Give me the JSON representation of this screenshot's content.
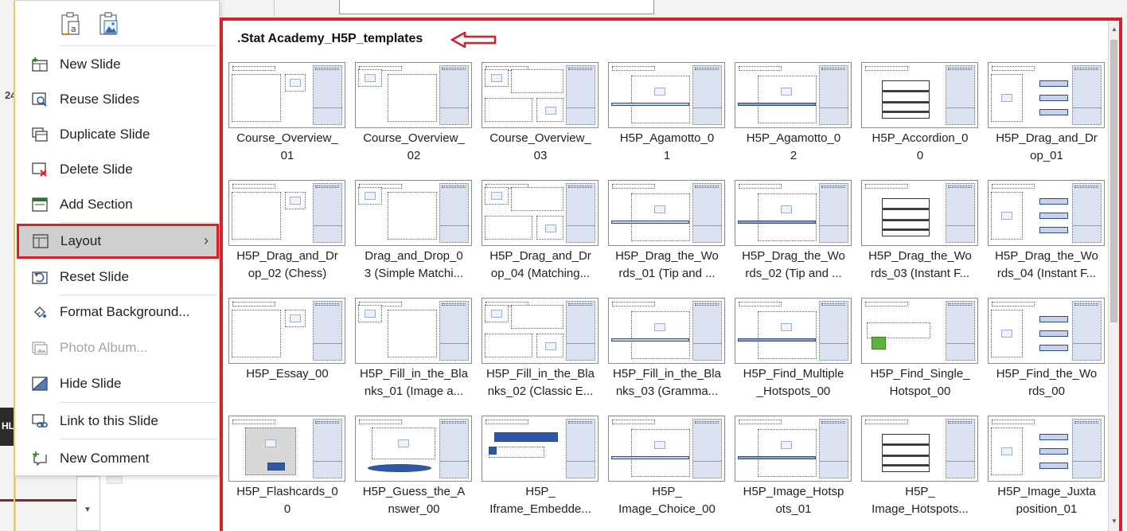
{
  "background": {
    "slide_number": "24",
    "dark_tab": "HL"
  },
  "context_menu": {
    "items": [
      {
        "label": "New Slide",
        "icon": "new-slide-icon",
        "enabled": true
      },
      {
        "label": "Reuse Slides",
        "icon": "reuse-slides-icon",
        "enabled": true
      },
      {
        "label": "Duplicate Slide",
        "icon": "duplicate-slide-icon",
        "enabled": true
      },
      {
        "label": "Delete Slide",
        "icon": "delete-slide-icon",
        "enabled": true
      },
      {
        "label": "Add Section",
        "icon": "add-section-icon",
        "enabled": true
      },
      {
        "label": "Layout",
        "icon": "layout-icon",
        "enabled": true,
        "highlighted": true,
        "has_submenu": true
      },
      {
        "label": "Reset Slide",
        "icon": "reset-slide-icon",
        "enabled": true
      },
      {
        "label": "Format Background...",
        "icon": "format-background-icon",
        "enabled": true
      },
      {
        "label": "Photo Album...",
        "icon": "photo-album-icon",
        "enabled": false
      },
      {
        "label": "Hide Slide",
        "icon": "hide-slide-icon",
        "enabled": true
      },
      {
        "label": "Link to this Slide",
        "icon": "link-slide-icon",
        "enabled": true
      },
      {
        "label": "New Comment",
        "icon": "new-comment-icon",
        "enabled": true
      }
    ],
    "submenu_chevron": "›",
    "colors": {
      "highlight_bg": "#cfcfcf",
      "annotation_red": "#d6202a"
    }
  },
  "gallery": {
    "title": ".Stat Academy_H5P_templates",
    "layouts": [
      {
        "l1": "Course_Overview_",
        "l2": "01"
      },
      {
        "l1": "Course_Overview_",
        "l2": "02"
      },
      {
        "l1": "Course_Overview_",
        "l2": "03"
      },
      {
        "l1": "H5P_Agamotto_0",
        "l2": "1"
      },
      {
        "l1": "H5P_Agamotto_0",
        "l2": "2"
      },
      {
        "l1": "H5P_Accordion_0",
        "l2": "0"
      },
      {
        "l1": "H5P_Drag_and_Dr",
        "l2": "op_01"
      },
      {
        "l1": "H5P_Drag_and_Dr",
        "l2": "op_02 (Chess)"
      },
      {
        "l1": "Drag_and_Drop_0",
        "l2": "3 (Simple Matchi..."
      },
      {
        "l1": "H5P_Drag_and_Dr",
        "l2": "op_04 (Matching..."
      },
      {
        "l1": "H5P_Drag_the_Wo",
        "l2": "rds_01 (Tip and ..."
      },
      {
        "l1": "H5P_Drag_the_Wo",
        "l2": "rds_02 (Tip and ..."
      },
      {
        "l1": "H5P_Drag_the_Wo",
        "l2": "rds_03 (Instant F..."
      },
      {
        "l1": "H5P_Drag_the_Wo",
        "l2": "rds_04 (Instant F..."
      },
      {
        "l1": "H5P_Essay_00",
        "l2": ""
      },
      {
        "l1": "H5P_Fill_in_the_Bla",
        "l2": "nks_01 (Image a..."
      },
      {
        "l1": "H5P_Fill_in_the_Bla",
        "l2": "nks_02 (Classic E..."
      },
      {
        "l1": "H5P_Fill_in_the_Bla",
        "l2": "nks_03 (Gramma..."
      },
      {
        "l1": "H5P_Find_Multiple",
        "l2": "_Hotspots_00"
      },
      {
        "l1": "H5P_Find_Single_",
        "l2": "Hotspot_00"
      },
      {
        "l1": "H5P_Find_the_Wo",
        "l2": "rds_00"
      },
      {
        "l1": "H5P_Flashcards_0",
        "l2": "0"
      },
      {
        "l1": "H5P_Guess_the_A",
        "l2": "nswer_00"
      },
      {
        "l1": "H5P_",
        "l2": "Iframe_Embedde..."
      },
      {
        "l1": "H5P_",
        "l2": "Image_Choice_00"
      },
      {
        "l1": "H5P_Image_Hotsp",
        "l2": "ots_01"
      },
      {
        "l1": "H5P_",
        "l2": "Image_Hotspots..."
      },
      {
        "l1": "H5P_Image_Juxta",
        "l2": "position_01"
      }
    ]
  }
}
